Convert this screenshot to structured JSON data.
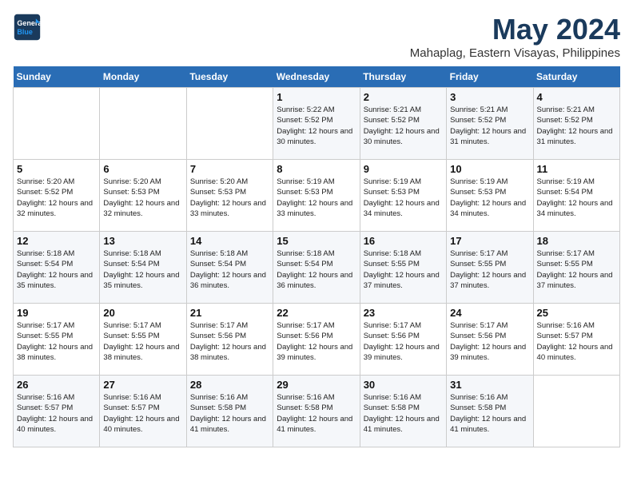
{
  "logo": {
    "line1": "General",
    "line2": "Blue"
  },
  "title": "May 2024",
  "subtitle": "Mahaplag, Eastern Visayas, Philippines",
  "days_header": [
    "Sunday",
    "Monday",
    "Tuesday",
    "Wednesday",
    "Thursday",
    "Friday",
    "Saturday"
  ],
  "weeks": [
    [
      {
        "day": "",
        "sunrise": "",
        "sunset": "",
        "daylight": ""
      },
      {
        "day": "",
        "sunrise": "",
        "sunset": "",
        "daylight": ""
      },
      {
        "day": "",
        "sunrise": "",
        "sunset": "",
        "daylight": ""
      },
      {
        "day": "1",
        "sunrise": "Sunrise: 5:22 AM",
        "sunset": "Sunset: 5:52 PM",
        "daylight": "Daylight: 12 hours and 30 minutes."
      },
      {
        "day": "2",
        "sunrise": "Sunrise: 5:21 AM",
        "sunset": "Sunset: 5:52 PM",
        "daylight": "Daylight: 12 hours and 30 minutes."
      },
      {
        "day": "3",
        "sunrise": "Sunrise: 5:21 AM",
        "sunset": "Sunset: 5:52 PM",
        "daylight": "Daylight: 12 hours and 31 minutes."
      },
      {
        "day": "4",
        "sunrise": "Sunrise: 5:21 AM",
        "sunset": "Sunset: 5:52 PM",
        "daylight": "Daylight: 12 hours and 31 minutes."
      }
    ],
    [
      {
        "day": "5",
        "sunrise": "Sunrise: 5:20 AM",
        "sunset": "Sunset: 5:52 PM",
        "daylight": "Daylight: 12 hours and 32 minutes."
      },
      {
        "day": "6",
        "sunrise": "Sunrise: 5:20 AM",
        "sunset": "Sunset: 5:53 PM",
        "daylight": "Daylight: 12 hours and 32 minutes."
      },
      {
        "day": "7",
        "sunrise": "Sunrise: 5:20 AM",
        "sunset": "Sunset: 5:53 PM",
        "daylight": "Daylight: 12 hours and 33 minutes."
      },
      {
        "day": "8",
        "sunrise": "Sunrise: 5:19 AM",
        "sunset": "Sunset: 5:53 PM",
        "daylight": "Daylight: 12 hours and 33 minutes."
      },
      {
        "day": "9",
        "sunrise": "Sunrise: 5:19 AM",
        "sunset": "Sunset: 5:53 PM",
        "daylight": "Daylight: 12 hours and 34 minutes."
      },
      {
        "day": "10",
        "sunrise": "Sunrise: 5:19 AM",
        "sunset": "Sunset: 5:53 PM",
        "daylight": "Daylight: 12 hours and 34 minutes."
      },
      {
        "day": "11",
        "sunrise": "Sunrise: 5:19 AM",
        "sunset": "Sunset: 5:54 PM",
        "daylight": "Daylight: 12 hours and 34 minutes."
      }
    ],
    [
      {
        "day": "12",
        "sunrise": "Sunrise: 5:18 AM",
        "sunset": "Sunset: 5:54 PM",
        "daylight": "Daylight: 12 hours and 35 minutes."
      },
      {
        "day": "13",
        "sunrise": "Sunrise: 5:18 AM",
        "sunset": "Sunset: 5:54 PM",
        "daylight": "Daylight: 12 hours and 35 minutes."
      },
      {
        "day": "14",
        "sunrise": "Sunrise: 5:18 AM",
        "sunset": "Sunset: 5:54 PM",
        "daylight": "Daylight: 12 hours and 36 minutes."
      },
      {
        "day": "15",
        "sunrise": "Sunrise: 5:18 AM",
        "sunset": "Sunset: 5:54 PM",
        "daylight": "Daylight: 12 hours and 36 minutes."
      },
      {
        "day": "16",
        "sunrise": "Sunrise: 5:18 AM",
        "sunset": "Sunset: 5:55 PM",
        "daylight": "Daylight: 12 hours and 37 minutes."
      },
      {
        "day": "17",
        "sunrise": "Sunrise: 5:17 AM",
        "sunset": "Sunset: 5:55 PM",
        "daylight": "Daylight: 12 hours and 37 minutes."
      },
      {
        "day": "18",
        "sunrise": "Sunrise: 5:17 AM",
        "sunset": "Sunset: 5:55 PM",
        "daylight": "Daylight: 12 hours and 37 minutes."
      }
    ],
    [
      {
        "day": "19",
        "sunrise": "Sunrise: 5:17 AM",
        "sunset": "Sunset: 5:55 PM",
        "daylight": "Daylight: 12 hours and 38 minutes."
      },
      {
        "day": "20",
        "sunrise": "Sunrise: 5:17 AM",
        "sunset": "Sunset: 5:55 PM",
        "daylight": "Daylight: 12 hours and 38 minutes."
      },
      {
        "day": "21",
        "sunrise": "Sunrise: 5:17 AM",
        "sunset": "Sunset: 5:56 PM",
        "daylight": "Daylight: 12 hours and 38 minutes."
      },
      {
        "day": "22",
        "sunrise": "Sunrise: 5:17 AM",
        "sunset": "Sunset: 5:56 PM",
        "daylight": "Daylight: 12 hours and 39 minutes."
      },
      {
        "day": "23",
        "sunrise": "Sunrise: 5:17 AM",
        "sunset": "Sunset: 5:56 PM",
        "daylight": "Daylight: 12 hours and 39 minutes."
      },
      {
        "day": "24",
        "sunrise": "Sunrise: 5:17 AM",
        "sunset": "Sunset: 5:56 PM",
        "daylight": "Daylight: 12 hours and 39 minutes."
      },
      {
        "day": "25",
        "sunrise": "Sunrise: 5:16 AM",
        "sunset": "Sunset: 5:57 PM",
        "daylight": "Daylight: 12 hours and 40 minutes."
      }
    ],
    [
      {
        "day": "26",
        "sunrise": "Sunrise: 5:16 AM",
        "sunset": "Sunset: 5:57 PM",
        "daylight": "Daylight: 12 hours and 40 minutes."
      },
      {
        "day": "27",
        "sunrise": "Sunrise: 5:16 AM",
        "sunset": "Sunset: 5:57 PM",
        "daylight": "Daylight: 12 hours and 40 minutes."
      },
      {
        "day": "28",
        "sunrise": "Sunrise: 5:16 AM",
        "sunset": "Sunset: 5:58 PM",
        "daylight": "Daylight: 12 hours and 41 minutes."
      },
      {
        "day": "29",
        "sunrise": "Sunrise: 5:16 AM",
        "sunset": "Sunset: 5:58 PM",
        "daylight": "Daylight: 12 hours and 41 minutes."
      },
      {
        "day": "30",
        "sunrise": "Sunrise: 5:16 AM",
        "sunset": "Sunset: 5:58 PM",
        "daylight": "Daylight: 12 hours and 41 minutes."
      },
      {
        "day": "31",
        "sunrise": "Sunrise: 5:16 AM",
        "sunset": "Sunset: 5:58 PM",
        "daylight": "Daylight: 12 hours and 41 minutes."
      },
      {
        "day": "",
        "sunrise": "",
        "sunset": "",
        "daylight": ""
      }
    ]
  ]
}
